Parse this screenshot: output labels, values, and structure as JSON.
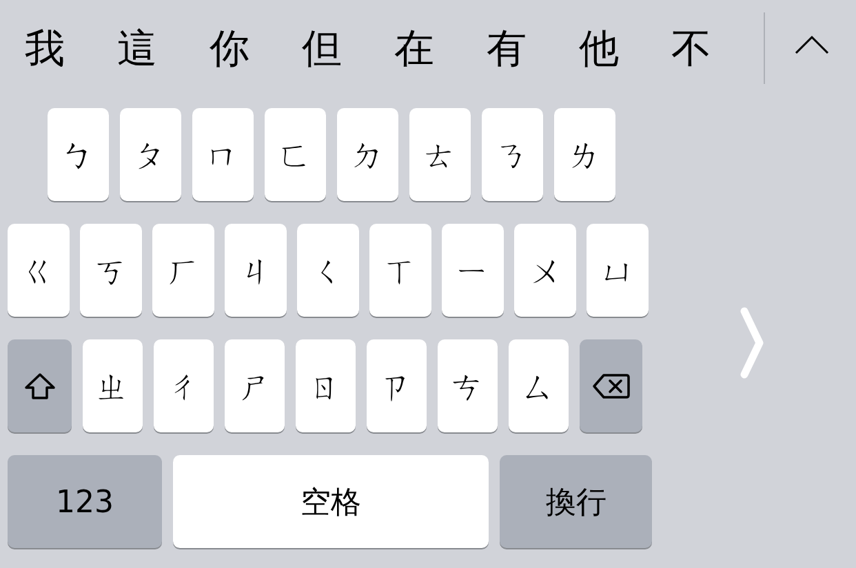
{
  "candidates": [
    "我",
    "這",
    "你",
    "但",
    "在",
    "有",
    "他",
    "不"
  ],
  "rows": [
    {
      "keys": [
        {
          "kind": "char",
          "label": "ㄅ"
        },
        {
          "kind": "char",
          "label": "ㄆ"
        },
        {
          "kind": "char",
          "label": "ㄇ"
        },
        {
          "kind": "char",
          "label": "ㄈ"
        },
        {
          "kind": "char",
          "label": "ㄉ"
        },
        {
          "kind": "char",
          "label": "ㄊ"
        },
        {
          "kind": "char",
          "label": "ㄋ"
        },
        {
          "kind": "char",
          "label": "ㄌ"
        }
      ]
    },
    {
      "keys": [
        {
          "kind": "char",
          "label": "ㄍ"
        },
        {
          "kind": "char",
          "label": "ㄎ"
        },
        {
          "kind": "char",
          "label": "ㄏ"
        },
        {
          "kind": "char",
          "label": "ㄐ"
        },
        {
          "kind": "char",
          "label": "ㄑ"
        },
        {
          "kind": "char",
          "label": "ㄒ"
        },
        {
          "kind": "char",
          "label": "ㄧ"
        },
        {
          "kind": "char",
          "label": "ㄨ"
        },
        {
          "kind": "char",
          "label": "ㄩ"
        }
      ]
    },
    {
      "keys": [
        {
          "kind": "shift"
        },
        {
          "kind": "char",
          "label": "ㄓ"
        },
        {
          "kind": "char",
          "label": "ㄔ"
        },
        {
          "kind": "char",
          "label": "ㄕ"
        },
        {
          "kind": "char",
          "label": "ㄖ"
        },
        {
          "kind": "char",
          "label": "ㄗ"
        },
        {
          "kind": "char",
          "label": "ㄘ"
        },
        {
          "kind": "char",
          "label": "ㄙ"
        },
        {
          "kind": "delete"
        }
      ]
    },
    {
      "keys": [
        {
          "kind": "mode",
          "label": "123"
        },
        {
          "kind": "space",
          "label": "空格"
        },
        {
          "kind": "return",
          "label": "換行"
        }
      ]
    }
  ]
}
